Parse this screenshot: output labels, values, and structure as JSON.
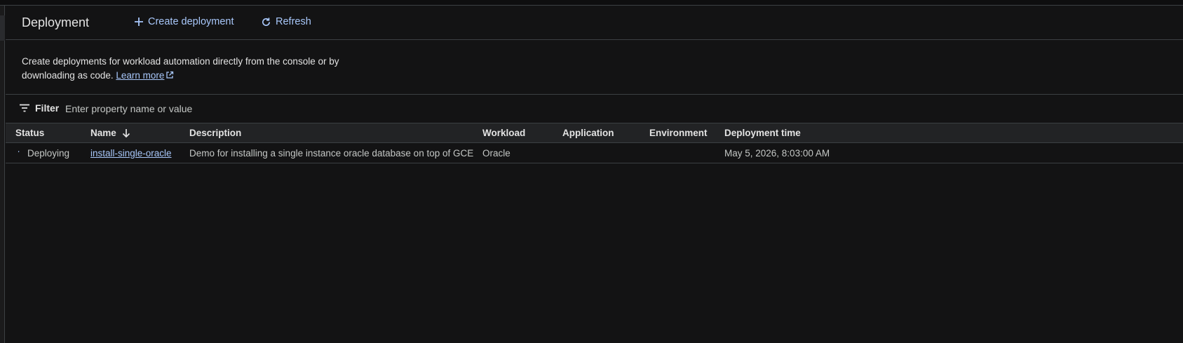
{
  "header": {
    "title": "Deployment",
    "create_label": "Create deployment",
    "refresh_label": "Refresh"
  },
  "intro": {
    "text": "Create deployments for workload automation directly from the console or by downloading as code.",
    "learn_more": "Learn more"
  },
  "filter": {
    "label": "Filter",
    "placeholder": "Enter property name or value"
  },
  "table": {
    "columns": {
      "status": "Status",
      "name": "Name",
      "description": "Description",
      "workload": "Workload",
      "application": "Application",
      "environment": "Environment",
      "deployment_time": "Deployment time"
    },
    "rows": [
      {
        "status": "Deploying",
        "name": "install-single-oracle",
        "description": "Demo for installing a single instance oracle database on top of GCE",
        "workload": "Oracle",
        "application": "",
        "environment": "",
        "deployment_time": "May 5, 2026, 8:03:00 AM"
      }
    ]
  },
  "icons": {
    "create": "plus-icon",
    "refresh": "refresh-icon",
    "external": "open-in-new-icon",
    "filter": "filter-list-icon",
    "sort": "arrow-down-icon",
    "status": "spinner-icon"
  },
  "colors": {
    "background": "#131314",
    "accent": "#a8c7fa",
    "text": "#e3e3e3",
    "muted_text": "#c4c7c5",
    "divider": "#3c4043",
    "table_header_bg": "#222325"
  }
}
